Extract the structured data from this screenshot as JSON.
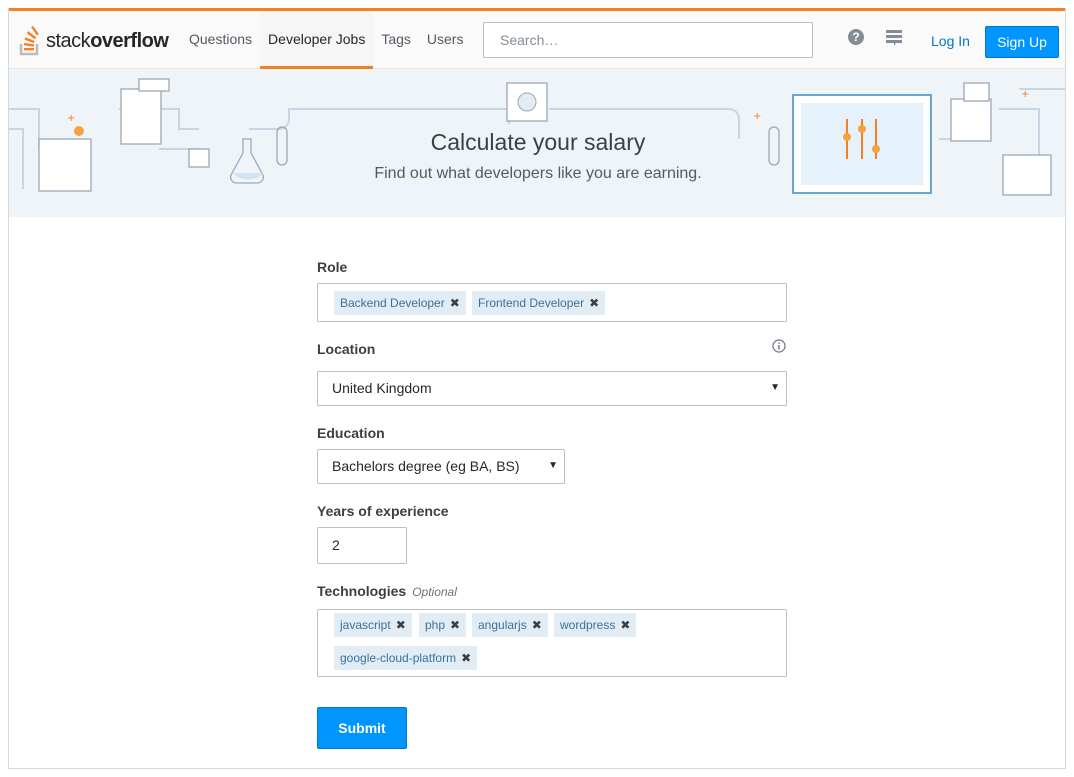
{
  "header": {
    "logo_prefix": "stack",
    "logo_suffix": "overflow",
    "nav": [
      {
        "label": "Questions",
        "active": false
      },
      {
        "label": "Developer Jobs",
        "active": true
      },
      {
        "label": "Tags",
        "active": false
      },
      {
        "label": "Users",
        "active": false
      }
    ],
    "search_placeholder": "Search…",
    "help_icon": "help-icon",
    "inbox_icon": "inbox-icon",
    "login_label": "Log In",
    "signup_label": "Sign Up",
    "colors": {
      "accent": "#f48024",
      "primary": "#0095ff",
      "link": "#0077cc"
    }
  },
  "banner": {
    "title": "Calculate your salary",
    "subtitle": "Find out what developers like you are earning."
  },
  "form": {
    "role": {
      "label": "Role",
      "tags": [
        "Backend Developer",
        "Frontend Developer"
      ]
    },
    "location": {
      "label": "Location",
      "value": "United Kingdom",
      "info_icon": "info-icon"
    },
    "education": {
      "label": "Education",
      "value": "Bachelors degree (eg BA, BS)"
    },
    "experience": {
      "label": "Years of experience",
      "value": "2"
    },
    "technologies": {
      "label": "Technologies",
      "optional": "Optional",
      "tags": [
        "javascript",
        "php",
        "angularjs",
        "wordpress",
        "google-cloud-platform"
      ]
    },
    "submit_label": "Submit"
  }
}
